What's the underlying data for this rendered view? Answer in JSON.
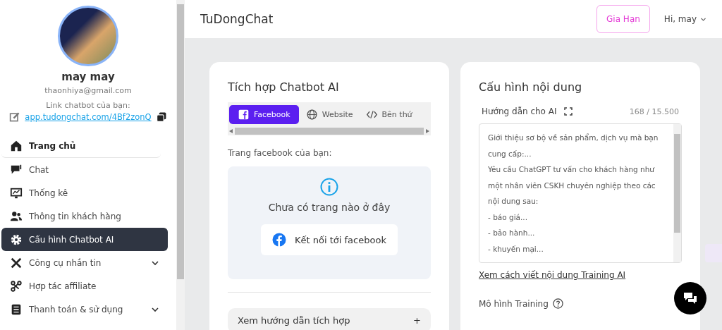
{
  "sidebar": {
    "user_name": "may may",
    "email": "thaonhiya@gmail.com",
    "link_label": "Link chatbot của bạn:",
    "link": "app.tudongchat.com/4Bf2zonQ",
    "items": [
      {
        "label": "Trang chủ",
        "selected": false,
        "expandable": false
      },
      {
        "label": "Chat",
        "selected": false,
        "expandable": false
      },
      {
        "label": "Thống kê",
        "selected": false,
        "expandable": false
      },
      {
        "label": "Thông tin khách hàng",
        "selected": false,
        "expandable": false
      },
      {
        "label": "Cấu hình Chatbot AI",
        "selected": true,
        "expandable": false
      },
      {
        "label": "Công cụ nhắn tin",
        "selected": false,
        "expandable": true
      },
      {
        "label": "Hợp tác affiliate",
        "selected": false,
        "expandable": false
      },
      {
        "label": "Thanh toán & sử dụng",
        "selected": false,
        "expandable": true
      }
    ]
  },
  "header": {
    "brand": "TuDongChat",
    "renew_button": "Gia Hạn",
    "user_menu": "Hi, may"
  },
  "integration": {
    "title": "Tích hợp Chatbot AI",
    "tabs": [
      {
        "label": "Facebook",
        "selected": true
      },
      {
        "label": "Website",
        "selected": false
      },
      {
        "label": "Bên thứ",
        "selected": false
      }
    ],
    "page_label": "Trang facebook của bạn:",
    "empty_text": "Chưa có trang nào ở đây",
    "connect_button": "Kết nối tới facebook",
    "guide": "Xem hướng dẫn tích hợp",
    "guide_toggle": "+"
  },
  "content": {
    "title": "Cấu hình nội dung",
    "field_label": "Hướng dẫn cho AI",
    "counter": "168 / 15.500",
    "lines": [
      "Giới thiệu sơ bộ về sản phẩm, dịch vụ mà bạn cung cấp:...",
      "Yêu cầu ChatGPT tư vấn cho khách hàng như một nhân viên CSKH chuyên nghiệp theo các nội dung sau:",
      "- báo giá...",
      "- bảo hành...",
      "- khuyến mại..."
    ],
    "help_link": "Xem cách viết nội dung Training AI",
    "model_label": "Mô hình Training"
  }
}
